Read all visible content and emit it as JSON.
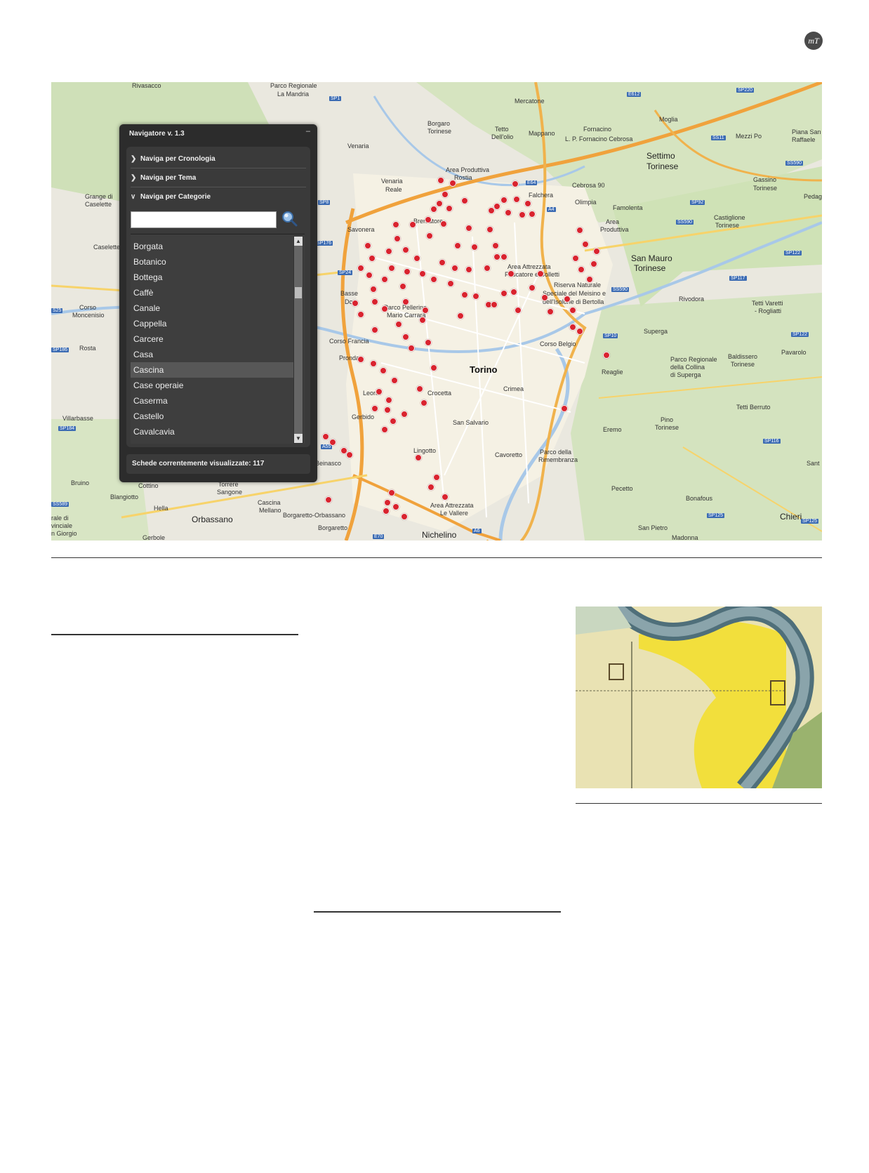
{
  "logo_text": "mT",
  "navigator": {
    "title": "Navigatore v. 1.3",
    "minimize": "–",
    "sections": [
      {
        "label": "Naviga per Cronologia",
        "icon": "chevron-right-icon"
      },
      {
        "label": "Naviga per Tema",
        "icon": "chevron-right-icon"
      },
      {
        "label": "Naviga per Categorie",
        "icon": "chevron-down-icon"
      }
    ],
    "search_value": "",
    "categories": [
      "Borgata",
      "Botanico",
      "Bottega",
      "Caffè",
      "Canale",
      "Cappella",
      "Carcere",
      "Casa",
      "Cascina",
      "Case operaie",
      "Caserma",
      "Castello",
      "Cavalcavia"
    ],
    "selected_category": "Cascina",
    "status_text": "Schede correntemente visualizzate: 117"
  },
  "map": {
    "labels": {
      "rivasacco": "Rivasacco",
      "parco_mandria": "Parco Regionale",
      "parco_mandria2": "La Mandria",
      "mercatone": "Mercatone",
      "borgaro": "Borgaro",
      "borgaro2": "Torinese",
      "tetto": "Tetto",
      "tetto2": "Dell'olio",
      "mappano": "Mappano",
      "fornacino": "Fornacino",
      "lp_fornacino": "L. P. Fornacino Cebrosa",
      "moglia": "Moglia",
      "mezzi_po": "Mezzi Po",
      "piana": "Piana San",
      "piana2": "Raffaele",
      "settimo": "Settimo",
      "settimo2": "Torinese",
      "venaria": "Venaria",
      "venaria_reale": "Venaria",
      "venaria_reale2": "Reale",
      "area_rosta": "Area Produttiva",
      "area_rosta2": "Rostia",
      "falchera": "Falchera",
      "cebrosa": "Cebrosa 90",
      "olimpia": "Olimpia",
      "famolenta": "Famolenta",
      "gassino": "Gassino",
      "gassino2": "Torinese",
      "pedaggio": "Pedagg",
      "castiglione": "Castiglione",
      "castiglione2": "Torinese",
      "area_lbl": "Area",
      "area_lbl2": "Produttiva",
      "grange": "Grange di",
      "grange2": "Caselette",
      "savonera": "Savonera",
      "brentatore": "Brentatore",
      "caselette": "Caselette",
      "san_mauro": "San Mauro",
      "san_mauro2": "Torinese",
      "area_attrezzata": "Area Attrezzata",
      "area_attrezzata2": "Pescatore e Colletti",
      "riserva": "Riserva Naturale",
      "riserva2": "Speciale del Meisino e",
      "riserva3": "dell'Isolone di Bertolla",
      "basse_dora": "Basse",
      "basse_dora2": "Dora",
      "rivodora": "Rivodora",
      "tetti_varetti": "Tetti Varetti",
      "tetti_varetti2": "- Rogliatti",
      "corso_moncenisio": "Corso",
      "corso_moncenisio2": "Moncenisio",
      "parco_pellerina": "Parco Pellerina",
      "parco_pellerina2": "Mario Carrara",
      "rosta": "Rosta",
      "corso_francia": "Corso Francia",
      "superga": "Superga",
      "pronda": "Pronda",
      "torino": "Torino",
      "corso_belgio": "Corso Belgio",
      "parco_collina": "Parco Regionale",
      "parco_collina2": "della Collina",
      "parco_collina3": "di Superga",
      "baldissero": "Baldissero",
      "baldissero2": "Torinese",
      "pavarolo": "Pavarolo",
      "reaglie": "Reaglie",
      "leona": "Leona",
      "crocetta": "Crocetta",
      "crimea": "Crimea",
      "villarbasse": "Villarbasse",
      "gerbido": "Gerbido",
      "san_salvario": "San Salvario",
      "tetti_berruto": "Tetti Berruto",
      "pino": "Pino",
      "pino2": "Torinese",
      "lingotto": "Lingotto",
      "cavoretto": "Cavoretto",
      "parco_rimembranza": "Parco della",
      "parco_rimembranza2": "Rimembranza",
      "eremo": "Eremo",
      "bruino": "Bruino",
      "cottino": "Cottino",
      "blangiotto": "Blangiotto",
      "beinasco": "Beinasco",
      "torrere": "Torrere",
      "torrere2": "Sangone",
      "cascina_mellano": "Cascina",
      "cascina_mellano2": "Mellano",
      "hella": "Hella",
      "pecetto": "Pecetto",
      "bonafous": "Bonafous",
      "orbassano": "Orbassano",
      "borgaretto_orb": "Borgaretto-Orbassano",
      "area_vallere": "Area Attrezzata",
      "area_vallere2": "Le Vallere",
      "chieri": "Chieri",
      "borgaretto": "Borgaretto",
      "nichelino": "Nichelino",
      "san_pietro": "San Pietro",
      "gerbole": "Gerbole",
      "madonna": "Madonna",
      "provinciale": "rale di",
      "provinciale2": "vinciale",
      "provinciale3": "n Giorgio",
      "sant": "Sant"
    },
    "road_badges": {
      "sp1": "SP1",
      "e612": "E612",
      "sp220": "SP220",
      "e64": "E64",
      "a4": "A4",
      "ss11": "SS11",
      "ss590": "SS590",
      "sp92": "SP92",
      "ss590b": "SS590",
      "sp8": "SP8",
      "sp176": "SP176",
      "sp24": "SP24",
      "sp122": "SP122",
      "sp117": "SP117",
      "ss590c": "SS590",
      "sp10": "SP10",
      "sp122b": "SP122",
      "ss25": "S25",
      "sp186": "SP186",
      "sp184": "SP184",
      "sp116": "SP116",
      "sp125": "SP125",
      "a55": "A55",
      "e70": "E70",
      "a6": "A6",
      "ss589": "SS589",
      "sp125b": "SP125"
    }
  }
}
